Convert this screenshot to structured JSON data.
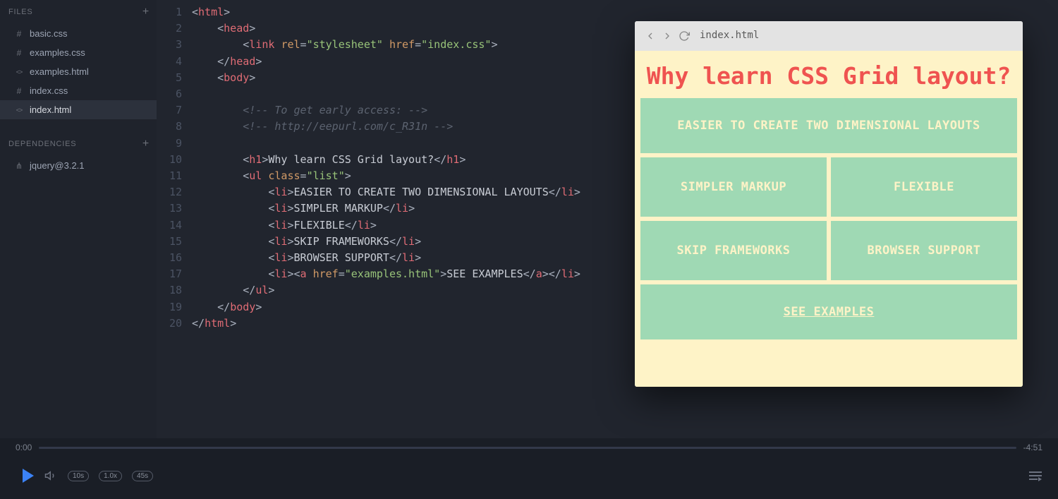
{
  "sidebar": {
    "files_label": "FILES",
    "deps_label": "DEPENDENCIES",
    "files": [
      {
        "name": "basic.css",
        "icon": "css",
        "selected": false
      },
      {
        "name": "examples.css",
        "icon": "css",
        "selected": false
      },
      {
        "name": "examples.html",
        "icon": "html",
        "selected": false
      },
      {
        "name": "index.css",
        "icon": "css",
        "selected": false
      },
      {
        "name": "index.html",
        "icon": "html",
        "selected": true
      }
    ],
    "deps": [
      {
        "name": "jquery@3.2.1",
        "icon": "dep"
      }
    ]
  },
  "editor": {
    "lines": [
      {
        "n": 1,
        "tokens": [
          [
            "br",
            "<"
          ],
          [
            "tag",
            "html"
          ],
          [
            "br",
            ">"
          ]
        ]
      },
      {
        "n": 2,
        "tokens": [
          [
            "sp",
            "    "
          ],
          [
            "br",
            "<"
          ],
          [
            "tag",
            "head"
          ],
          [
            "br",
            ">"
          ]
        ]
      },
      {
        "n": 3,
        "tokens": [
          [
            "sp",
            "        "
          ],
          [
            "br",
            "<"
          ],
          [
            "tag",
            "link"
          ],
          [
            "sp",
            " "
          ],
          [
            "attr",
            "rel"
          ],
          [
            "br",
            "="
          ],
          [
            "str",
            "\"stylesheet\""
          ],
          [
            "sp",
            " "
          ],
          [
            "attr",
            "href"
          ],
          [
            "br",
            "="
          ],
          [
            "str",
            "\"index.css\""
          ],
          [
            "br",
            ">"
          ]
        ]
      },
      {
        "n": 4,
        "tokens": [
          [
            "sp",
            "    "
          ],
          [
            "br",
            "</"
          ],
          [
            "tag",
            "head"
          ],
          [
            "br",
            ">"
          ]
        ]
      },
      {
        "n": 5,
        "tokens": [
          [
            "sp",
            "    "
          ],
          [
            "br",
            "<"
          ],
          [
            "tag",
            "body"
          ],
          [
            "br",
            ">"
          ]
        ]
      },
      {
        "n": 6,
        "tokens": []
      },
      {
        "n": 7,
        "tokens": [
          [
            "sp",
            "        "
          ],
          [
            "com",
            "<!-- To get early access: -->"
          ]
        ]
      },
      {
        "n": 8,
        "tokens": [
          [
            "sp",
            "        "
          ],
          [
            "com",
            "<!-- http://eepurl.com/c_R31n -->"
          ]
        ]
      },
      {
        "n": 9,
        "tokens": []
      },
      {
        "n": 10,
        "tokens": [
          [
            "sp",
            "        "
          ],
          [
            "br",
            "<"
          ],
          [
            "tag",
            "h1"
          ],
          [
            "br",
            ">"
          ],
          [
            "txt",
            "Why learn CSS Grid layout?"
          ],
          [
            "br",
            "</"
          ],
          [
            "tag",
            "h1"
          ],
          [
            "br",
            ">"
          ]
        ]
      },
      {
        "n": 11,
        "tokens": [
          [
            "sp",
            "        "
          ],
          [
            "br",
            "<"
          ],
          [
            "tag",
            "ul"
          ],
          [
            "sp",
            " "
          ],
          [
            "attr",
            "class"
          ],
          [
            "br",
            "="
          ],
          [
            "str",
            "\"list\""
          ],
          [
            "br",
            ">"
          ]
        ]
      },
      {
        "n": 12,
        "tokens": [
          [
            "sp",
            "            "
          ],
          [
            "br",
            "<"
          ],
          [
            "tag",
            "li"
          ],
          [
            "br",
            ">"
          ],
          [
            "txt",
            "EASIER TO CREATE TWO DIMENSIONAL LAYOUTS"
          ],
          [
            "br",
            "</"
          ],
          [
            "tag",
            "li"
          ],
          [
            "br",
            ">"
          ]
        ]
      },
      {
        "n": 13,
        "tokens": [
          [
            "sp",
            "            "
          ],
          [
            "br",
            "<"
          ],
          [
            "tag",
            "li"
          ],
          [
            "br",
            ">"
          ],
          [
            "txt",
            "SIMPLER MARKUP"
          ],
          [
            "br",
            "</"
          ],
          [
            "tag",
            "li"
          ],
          [
            "br",
            ">"
          ]
        ]
      },
      {
        "n": 14,
        "tokens": [
          [
            "sp",
            "            "
          ],
          [
            "br",
            "<"
          ],
          [
            "tag",
            "li"
          ],
          [
            "br",
            ">"
          ],
          [
            "txt",
            "FLEXIBLE"
          ],
          [
            "br",
            "</"
          ],
          [
            "tag",
            "li"
          ],
          [
            "br",
            ">"
          ]
        ]
      },
      {
        "n": 15,
        "tokens": [
          [
            "sp",
            "            "
          ],
          [
            "br",
            "<"
          ],
          [
            "tag",
            "li"
          ],
          [
            "br",
            ">"
          ],
          [
            "txt",
            "SKIP FRAMEWORKS"
          ],
          [
            "br",
            "</"
          ],
          [
            "tag",
            "li"
          ],
          [
            "br",
            ">"
          ]
        ]
      },
      {
        "n": 16,
        "tokens": [
          [
            "sp",
            "            "
          ],
          [
            "br",
            "<"
          ],
          [
            "tag",
            "li"
          ],
          [
            "br",
            ">"
          ],
          [
            "txt",
            "BROWSER SUPPORT"
          ],
          [
            "br",
            "</"
          ],
          [
            "tag",
            "li"
          ],
          [
            "br",
            ">"
          ]
        ]
      },
      {
        "n": 17,
        "tokens": [
          [
            "sp",
            "            "
          ],
          [
            "br",
            "<"
          ],
          [
            "tag",
            "li"
          ],
          [
            "br",
            ">"
          ],
          [
            "br",
            "<"
          ],
          [
            "tag",
            "a"
          ],
          [
            "sp",
            " "
          ],
          [
            "attr",
            "href"
          ],
          [
            "br",
            "="
          ],
          [
            "str",
            "\"examples.html\""
          ],
          [
            "br",
            ">"
          ],
          [
            "txt",
            "SEE EXAMPLES"
          ],
          [
            "br",
            "</"
          ],
          [
            "tag",
            "a"
          ],
          [
            "br",
            ">"
          ],
          [
            "br",
            "</"
          ],
          [
            "tag",
            "li"
          ],
          [
            "br",
            ">"
          ]
        ]
      },
      {
        "n": 18,
        "tokens": [
          [
            "sp",
            "        "
          ],
          [
            "br",
            "</"
          ],
          [
            "tag",
            "ul"
          ],
          [
            "br",
            ">"
          ]
        ]
      },
      {
        "n": 19,
        "tokens": [
          [
            "sp",
            "    "
          ],
          [
            "br",
            "</"
          ],
          [
            "tag",
            "body"
          ],
          [
            "br",
            ">"
          ]
        ]
      },
      {
        "n": 20,
        "tokens": [
          [
            "br",
            "</"
          ],
          [
            "tag",
            "html"
          ],
          [
            "br",
            ">"
          ]
        ]
      }
    ]
  },
  "preview": {
    "url": "index.html",
    "title": "Why learn CSS Grid layout?",
    "cells": [
      {
        "text": "EASIER TO CREATE TWO DIMENSIONAL LAYOUTS",
        "full": true,
        "link": false
      },
      {
        "text": "SIMPLER MARKUP",
        "full": false,
        "link": false
      },
      {
        "text": "FLEXIBLE",
        "full": false,
        "link": false
      },
      {
        "text": "SKIP FRAMEWORKS",
        "full": false,
        "link": false
      },
      {
        "text": "BROWSER SUPPORT",
        "full": false,
        "link": false
      },
      {
        "text": "SEE EXAMPLES",
        "full": true,
        "link": true
      }
    ]
  },
  "player": {
    "current": "0:00",
    "remaining": "-4:51",
    "speed": "1.0x",
    "skip_back": "10s",
    "skip_fwd": "45s"
  }
}
